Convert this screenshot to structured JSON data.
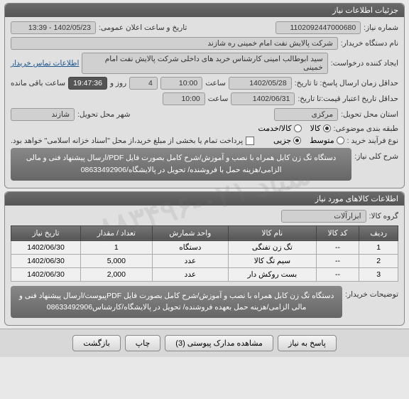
{
  "watermark": "ستاد ۰۲۱-۸۸۳۴۹۶",
  "panel1": {
    "title": "جزئیات اطلاعات نیاز",
    "niaz_no_label": "شماره نیاز:",
    "niaz_no": "1102092447000680",
    "public_time_label": "تاریخ و ساعت اعلان عمومی:",
    "public_time": "1402/05/23 - 13:39",
    "buyer_org_label": "نام دستگاه خریدار:",
    "buyer_org": "شرکت پالایش نفت امام خمینی  ره  شازند",
    "creator_label": "ایجاد کننده درخواست:",
    "creator": "سید ابوطالب  امینی کارشناس خرید های داخلی  شرکت پالایش نفت امام خمینی",
    "contact_link": "اطلاعات تماس خریدار",
    "deadline_label": "حداقل زمان ارسال پاسخ:  تا تاریخ:",
    "deadline_date": "1402/05/28",
    "saat": "ساعت",
    "deadline_time": "10:00",
    "days": "4",
    "rooz_va": "روز و",
    "countdown": "19:47:36",
    "remain": "ساعت باقی مانده",
    "validity_label": "حداقل تاریخ اعتبار قیمت:تا تاریخ:",
    "validity_date": "1402/06/31",
    "validity_time": "10:00",
    "province_label": "استان محل تحویل:",
    "province": "مرکزی",
    "city_label": "شهر محل تحویل:",
    "city": "شازند",
    "category_label": "طبقه بندی موضوعی:",
    "cat_kala": "کالا",
    "cat_khedmat": "کالا/خدمت",
    "process_label": "نوع فرآیند خرید :",
    "proc_middle": "متوسط",
    "proc_small": "جزیی",
    "payment_note": "پرداخت تمام یا بخشی از مبلغ خرید،از محل \"اسناد خزانه اسلامی\" خواهد بود.",
    "desc_label": "شرح کلی نیاز:",
    "desc": "دستگاه تگ زن کابل همراه با نصب و آموزش/شرح کامل بصورت فایل PDF/ارسال پیشنهاد فنی و مالی الزامی/هزینه حمل با فروشنده/ تحویل در پالایشگاه/08633492906"
  },
  "panel2": {
    "title": "اطلاعات کالاهای مورد نیاز",
    "group_label": "گروه کالا:",
    "group": "ابزارآلات",
    "cols": {
      "row": "ردیف",
      "code": "کد کالا",
      "name": "نام کالا",
      "unit": "واحد شمارش",
      "qty": "تعداد / مقدار",
      "date": "تاریخ نیاز"
    },
    "rows": [
      {
        "r": "1",
        "code": "--",
        "name": "تگ زن تفنگی",
        "unit": "دستگاه",
        "qty": "1",
        "date": "1402/06/30"
      },
      {
        "r": "2",
        "code": "--",
        "name": "سیم تگ کالا",
        "unit": "عدد",
        "qty": "5,000",
        "date": "1402/06/30"
      },
      {
        "r": "3",
        "code": "--",
        "name": "بست روکش دار",
        "unit": "عدد",
        "qty": "2,000",
        "date": "1402/06/30"
      }
    ],
    "buyer_note_label": "توضیحات خریدار:",
    "buyer_note": "دستگاه تگ زن کابل همراه با نصب و آموزش/شرح کامل بصورت فایل PDFپیوست/ارسال پیشنهاد فنی و مالی الزامی/هزینه حمل بعهده فروشنده/ تحویل در پالایشگاه/کارشناس08633492906"
  },
  "buttons": {
    "reply": "پاسخ به نیاز",
    "attachments": "مشاهده مدارک پیوستی  (3)",
    "print": "چاپ",
    "back": "بازگشت"
  }
}
